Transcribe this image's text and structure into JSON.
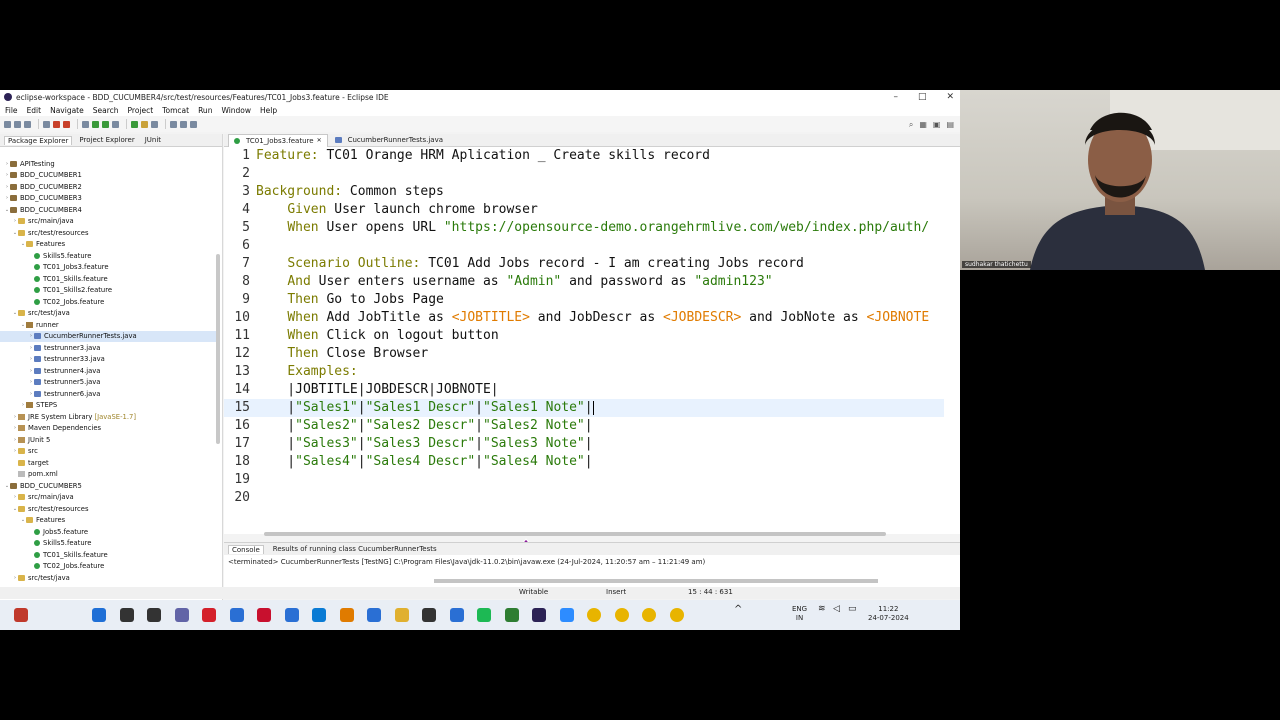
{
  "window": {
    "title": "eclipse-workspace - BDD_CUCUMBER4/src/test/resources/Features/TC01_Jobs3.feature - Eclipse IDE",
    "minimize": "–",
    "maximize": "□",
    "close": "✕"
  },
  "menu": [
    "File",
    "Edit",
    "Navigate",
    "Search",
    "Project",
    "Tomcat",
    "Run",
    "Window",
    "Help"
  ],
  "left_tabs": [
    "Package Explorer",
    "Project Explorer",
    "JUnit"
  ],
  "tree": [
    {
      "label": "APITesting",
      "indent": 0,
      "icon": "proj",
      "arrow": "›"
    },
    {
      "label": "BDD_CUCUMBER1",
      "indent": 0,
      "icon": "proj",
      "arrow": "›"
    },
    {
      "label": "BDD_CUCUMBER2",
      "indent": 0,
      "icon": "proj",
      "arrow": "›"
    },
    {
      "label": "BDD_CUCUMBER3",
      "indent": 0,
      "icon": "proj",
      "arrow": "›"
    },
    {
      "label": "BDD_CUCUMBER4",
      "indent": 0,
      "icon": "proj",
      "arrow": "⌄"
    },
    {
      "label": "src/main/java",
      "indent": 1,
      "icon": "folder",
      "arrow": "›"
    },
    {
      "label": "src/test/resources",
      "indent": 1,
      "icon": "folder",
      "arrow": "⌄"
    },
    {
      "label": "Features",
      "indent": 2,
      "icon": "folder",
      "arrow": "⌄"
    },
    {
      "label": "Skills5.feature",
      "indent": 3,
      "icon": "feat",
      "arrow": ""
    },
    {
      "label": "TC01_Jobs3.feature",
      "indent": 3,
      "icon": "feat",
      "arrow": ""
    },
    {
      "label": "TC01_Skills.feature",
      "indent": 3,
      "icon": "feat",
      "arrow": ""
    },
    {
      "label": "TC01_Skills2.feature",
      "indent": 3,
      "icon": "feat",
      "arrow": ""
    },
    {
      "label": "TC02_Jobs.feature",
      "indent": 3,
      "icon": "feat",
      "arrow": ""
    },
    {
      "label": "src/test/java",
      "indent": 1,
      "icon": "folder",
      "arrow": "⌄"
    },
    {
      "label": "runner",
      "indent": 2,
      "icon": "pkg",
      "arrow": "⌄"
    },
    {
      "label": "CucumberRunnerTests.java",
      "indent": 3,
      "icon": "java",
      "arrow": "›",
      "selected": true
    },
    {
      "label": "testrunner3.java",
      "indent": 3,
      "icon": "java",
      "arrow": "›"
    },
    {
      "label": "testrunner33.java",
      "indent": 3,
      "icon": "java",
      "arrow": "›"
    },
    {
      "label": "testrunner4.java",
      "indent": 3,
      "icon": "java",
      "arrow": "›"
    },
    {
      "label": "testrunner5.java",
      "indent": 3,
      "icon": "java",
      "arrow": "›"
    },
    {
      "label": "testrunner6.java",
      "indent": 3,
      "icon": "java",
      "arrow": "›"
    },
    {
      "label": "STEPS",
      "indent": 2,
      "icon": "pkg",
      "arrow": "›"
    },
    {
      "label": "JRE System Library",
      "suffix": "[JavaSE-1.7]",
      "indent": 1,
      "icon": "lib",
      "arrow": "›"
    },
    {
      "label": "Maven Dependencies",
      "indent": 1,
      "icon": "lib",
      "arrow": "›"
    },
    {
      "label": "JUnit 5",
      "indent": 1,
      "icon": "lib",
      "arrow": "›"
    },
    {
      "label": "src",
      "indent": 1,
      "icon": "folder",
      "arrow": "›"
    },
    {
      "label": "target",
      "indent": 1,
      "icon": "folder",
      "arrow": ""
    },
    {
      "label": "pom.xml",
      "indent": 1,
      "icon": "file",
      "arrow": ""
    },
    {
      "label": "BDD_CUCUMBER5",
      "indent": 0,
      "icon": "proj",
      "arrow": "⌄"
    },
    {
      "label": "src/main/java",
      "indent": 1,
      "icon": "folder",
      "arrow": "›"
    },
    {
      "label": "src/test/resources",
      "indent": 1,
      "icon": "folder",
      "arrow": "⌄"
    },
    {
      "label": "Features",
      "indent": 2,
      "icon": "folder",
      "arrow": "⌄"
    },
    {
      "label": "Jobs5.feature",
      "indent": 3,
      "icon": "feat",
      "arrow": ""
    },
    {
      "label": "Skills5.feature",
      "indent": 3,
      "icon": "feat",
      "arrow": ""
    },
    {
      "label": "TC01_Skills.feature",
      "indent": 3,
      "icon": "feat",
      "arrow": ""
    },
    {
      "label": "TC02_Jobs.feature",
      "indent": 3,
      "icon": "feat",
      "arrow": ""
    },
    {
      "label": "src/test/java",
      "indent": 1,
      "icon": "folder",
      "arrow": "›"
    }
  ],
  "editor_tabs": [
    {
      "label": "TC01_Jobs3.feature",
      "active": true,
      "close": "✕"
    },
    {
      "label": "CucumberRunnerTests.java",
      "active": false
    }
  ],
  "code": [
    {
      "n": "1",
      "parts": [
        [
          "kw",
          "Feature: "
        ],
        [
          "txt",
          "TC01 Orange HRM Aplication _ Create skills record"
        ]
      ]
    },
    {
      "n": "2",
      "parts": []
    },
    {
      "n": "3",
      "parts": [
        [
          "kw",
          "Background: "
        ],
        [
          "txt",
          "Common steps"
        ]
      ]
    },
    {
      "n": "4",
      "parts": [
        [
          "txt",
          "    "
        ],
        [
          "kw",
          "Given "
        ],
        [
          "txt",
          "User launch chrome browser"
        ]
      ]
    },
    {
      "n": "5",
      "parts": [
        [
          "txt",
          "    "
        ],
        [
          "kw",
          "When "
        ],
        [
          "txt",
          "User opens URL "
        ],
        [
          "str",
          "\"https://opensource-demo.orangehrmlive.com/web/index.php/auth/"
        ]
      ]
    },
    {
      "n": "6",
      "parts": []
    },
    {
      "n": "7",
      "parts": [
        [
          "txt",
          "    "
        ],
        [
          "kw",
          "Scenario Outline: "
        ],
        [
          "txt",
          "TC01 Add Jobs record - I am creating Jobs record"
        ]
      ]
    },
    {
      "n": "8",
      "parts": [
        [
          "txt",
          "    "
        ],
        [
          "kw",
          "And "
        ],
        [
          "txt",
          "User enters username as "
        ],
        [
          "str",
          "\"Admin\""
        ],
        [
          "txt",
          " and password as "
        ],
        [
          "str",
          "\"admin123\""
        ]
      ]
    },
    {
      "n": "9",
      "parts": [
        [
          "txt",
          "    "
        ],
        [
          "kw",
          "Then "
        ],
        [
          "txt",
          "Go to Jobs Page"
        ]
      ]
    },
    {
      "n": "10",
      "parts": [
        [
          "txt",
          "    "
        ],
        [
          "kw",
          "When "
        ],
        [
          "txt",
          "Add JobTitle as "
        ],
        [
          "ph",
          "<JOBTITLE>"
        ],
        [
          "txt",
          " and JobDescr as "
        ],
        [
          "ph",
          "<JOBDESCR>"
        ],
        [
          "txt",
          " and JobNote as "
        ],
        [
          "ph",
          "<JOBNOTE"
        ]
      ]
    },
    {
      "n": "11",
      "parts": [
        [
          "txt",
          "    "
        ],
        [
          "kw",
          "When "
        ],
        [
          "txt",
          "Click on logout button"
        ]
      ]
    },
    {
      "n": "12",
      "parts": [
        [
          "txt",
          "    "
        ],
        [
          "kw",
          "Then "
        ],
        [
          "txt",
          "Close Browser"
        ]
      ]
    },
    {
      "n": "13",
      "parts": [
        [
          "txt",
          "    "
        ],
        [
          "kw",
          "Examples:"
        ]
      ]
    },
    {
      "n": "14",
      "parts": [
        [
          "txt",
          "    |JOBTITLE|JOBDESCR|JOBNOTE|"
        ]
      ]
    },
    {
      "n": "15",
      "parts": [
        [
          "txt",
          "    |"
        ],
        [
          "str",
          "\"Sales1\""
        ],
        [
          "txt",
          "|"
        ],
        [
          "str",
          "\"Sales1 Descr\""
        ],
        [
          "txt",
          "|"
        ],
        [
          "str",
          "\"Sales1 Note\""
        ],
        [
          "txt",
          "|"
        ]
      ],
      "current": true
    },
    {
      "n": "16",
      "parts": [
        [
          "txt",
          "    |"
        ],
        [
          "str",
          "\"Sales2\""
        ],
        [
          "txt",
          "|"
        ],
        [
          "str",
          "\"Sales2 Descr\""
        ],
        [
          "txt",
          "|"
        ],
        [
          "str",
          "\"Sales2 Note\""
        ],
        [
          "txt",
          "|"
        ]
      ]
    },
    {
      "n": "17",
      "parts": [
        [
          "txt",
          "    |"
        ],
        [
          "str",
          "\"Sales3\""
        ],
        [
          "txt",
          "|"
        ],
        [
          "str",
          "\"Sales3 Descr\""
        ],
        [
          "txt",
          "|"
        ],
        [
          "str",
          "\"Sales3 Note\""
        ],
        [
          "txt",
          "|"
        ]
      ]
    },
    {
      "n": "18",
      "parts": [
        [
          "txt",
          "    |"
        ],
        [
          "str",
          "\"Sales4\""
        ],
        [
          "txt",
          "|"
        ],
        [
          "str",
          "\"Sales4 Descr\""
        ],
        [
          "txt",
          "|"
        ],
        [
          "str",
          "\"Sales4 Note\""
        ],
        [
          "txt",
          "|"
        ]
      ]
    },
    {
      "n": "19",
      "parts": []
    },
    {
      "n": "20",
      "parts": []
    }
  ],
  "console": {
    "tabs": [
      "Console",
      "Results of running class CucumberRunnerTests"
    ],
    "line": "<terminated> CucumberRunnerTests [TestNG] C:\\Program Files\\Java\\jdk-11.0.2\\bin\\javaw.exe  (24-Jul-2024, 11:20:57 am – 11:21:49 am)"
  },
  "status": {
    "mode": "Writable",
    "insert": "Insert",
    "position": "15 : 44 : 631"
  },
  "taskbar": {
    "lang": "ENG",
    "region": "IN",
    "time": "11:22",
    "date": "24-07-2024",
    "apps": [
      "windows-start-icon",
      "search-icon",
      "task-view-icon",
      "teams-icon",
      "opera-icon",
      "store-icon",
      "mcafee-icon",
      "snipping-icon",
      "edge-icon",
      "app-icon",
      "mail-icon",
      "explorer-icon",
      "app2-icon",
      "store2-icon",
      "spotify-icon",
      "notepad-icon",
      "eclipse-icon",
      "zoom-icon",
      "chrome-icon",
      "chrome2-icon",
      "chrome3-icon",
      "chrome4-icon"
    ]
  },
  "webcam": {
    "name": "sudhakar thatichettu"
  },
  "colors": {
    "keyword": "#7b7b00",
    "string": "#2a7a0a",
    "placeholder": "#e07b00"
  }
}
